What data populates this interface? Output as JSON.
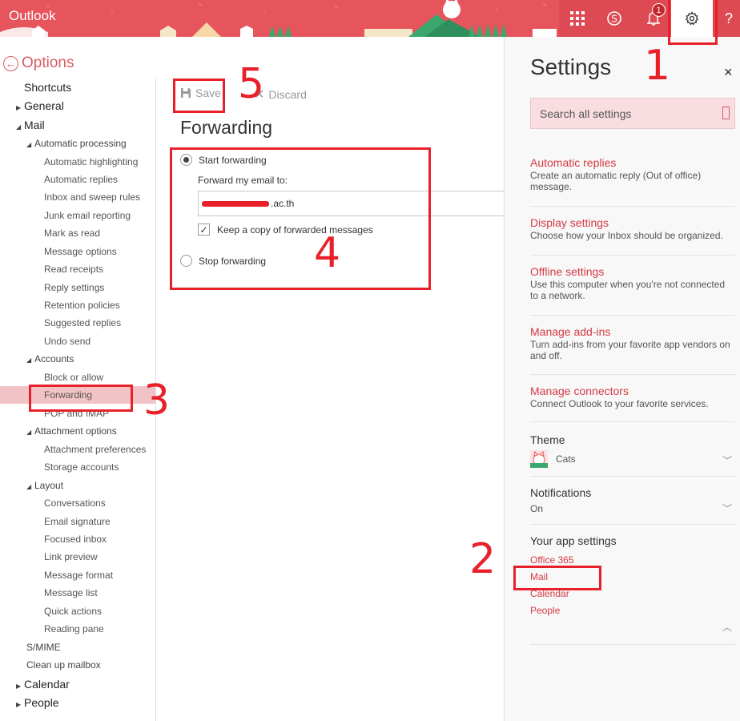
{
  "topbar": {
    "app_title": "Outlook",
    "waffle_icon": "app-launcher-icon",
    "skype_icon": "skype-icon",
    "bell_icon": "bell-icon",
    "notification_count": "1",
    "gear_icon": "gear-icon",
    "help_label": "?"
  },
  "nav": {
    "options_label": "Options",
    "items": [
      {
        "label": "Shortcuts",
        "level": 0,
        "arrow": ""
      },
      {
        "label": "General",
        "level": 0,
        "arrow": "collapsed"
      },
      {
        "label": "Mail",
        "level": 0,
        "arrow": "expanded"
      },
      {
        "label": "Automatic processing",
        "level": 1,
        "arrow": "expanded"
      },
      {
        "label": "Automatic highlighting",
        "level": 2,
        "arrow": ""
      },
      {
        "label": "Automatic replies",
        "level": 2,
        "arrow": ""
      },
      {
        "label": "Inbox and sweep rules",
        "level": 2,
        "arrow": ""
      },
      {
        "label": "Junk email reporting",
        "level": 2,
        "arrow": ""
      },
      {
        "label": "Mark as read",
        "level": 2,
        "arrow": ""
      },
      {
        "label": "Message options",
        "level": 2,
        "arrow": ""
      },
      {
        "label": "Read receipts",
        "level": 2,
        "arrow": ""
      },
      {
        "label": "Reply settings",
        "level": 2,
        "arrow": ""
      },
      {
        "label": "Retention policies",
        "level": 2,
        "arrow": ""
      },
      {
        "label": "Suggested replies",
        "level": 2,
        "arrow": ""
      },
      {
        "label": "Undo send",
        "level": 2,
        "arrow": ""
      },
      {
        "label": "Accounts",
        "level": 1,
        "arrow": "expanded"
      },
      {
        "label": "Block or allow",
        "level": 2,
        "arrow": ""
      },
      {
        "label": "Forwarding",
        "level": 2,
        "arrow": "",
        "selected": true
      },
      {
        "label": "POP and IMAP",
        "level": 2,
        "arrow": ""
      },
      {
        "label": "Attachment options",
        "level": 1,
        "arrow": "expanded"
      },
      {
        "label": "Attachment preferences",
        "level": 2,
        "arrow": ""
      },
      {
        "label": "Storage accounts",
        "level": 2,
        "arrow": ""
      },
      {
        "label": "Layout",
        "level": 1,
        "arrow": "expanded"
      },
      {
        "label": "Conversations",
        "level": 2,
        "arrow": ""
      },
      {
        "label": "Email signature",
        "level": 2,
        "arrow": ""
      },
      {
        "label": "Focused inbox",
        "level": 2,
        "arrow": ""
      },
      {
        "label": "Link preview",
        "level": 2,
        "arrow": ""
      },
      {
        "label": "Message format",
        "level": 2,
        "arrow": ""
      },
      {
        "label": "Message list",
        "level": 2,
        "arrow": ""
      },
      {
        "label": "Quick actions",
        "level": 2,
        "arrow": ""
      },
      {
        "label": "Reading pane",
        "level": 2,
        "arrow": ""
      },
      {
        "label": "S/MIME",
        "level": 1,
        "arrow": ""
      },
      {
        "label": "Clean up mailbox",
        "level": 1,
        "arrow": ""
      },
      {
        "label": "Calendar",
        "level": 0,
        "arrow": "collapsed"
      },
      {
        "label": "People",
        "level": 0,
        "arrow": "collapsed"
      }
    ]
  },
  "main": {
    "save_label": "Save",
    "discard_label": "Discard",
    "title": "Forwarding",
    "start_forwarding": "Start forwarding",
    "forward_to_label": "Forward my email to:",
    "forward_email_visible": ".ac.th",
    "keep_copy": "Keep a copy of forwarded messages",
    "keep_copy_checked": true,
    "stop_forwarding": "Stop forwarding",
    "selected_option": "start"
  },
  "settings": {
    "title": "Settings",
    "close_label": "×",
    "search_placeholder": "Search all settings",
    "links": [
      {
        "title": "Automatic replies",
        "desc": "Create an automatic reply (Out of office) message."
      },
      {
        "title": "Display settings",
        "desc": "Choose how your Inbox should be organized."
      },
      {
        "title": "Offline settings",
        "desc": "Use this computer when you're not connected to a network."
      },
      {
        "title": "Manage add-ins",
        "desc": "Turn add-ins from your favorite app vendors on and off."
      },
      {
        "title": "Manage connectors",
        "desc": "Connect Outlook to your favorite services."
      }
    ],
    "theme_label": "Theme",
    "theme_value": "Cats",
    "notifications_label": "Notifications",
    "notifications_value": "On",
    "app_settings_label": "Your app settings",
    "app_links": [
      "Office 365",
      "Mail",
      "Calendar",
      "People"
    ]
  },
  "annotations": [
    "1",
    "2",
    "3",
    "4",
    "5"
  ],
  "colors": {
    "accent": "#d33a44",
    "topbar": "#e6545c",
    "annotation": "#e8202a",
    "selected_nav": "#f2c3c6"
  }
}
